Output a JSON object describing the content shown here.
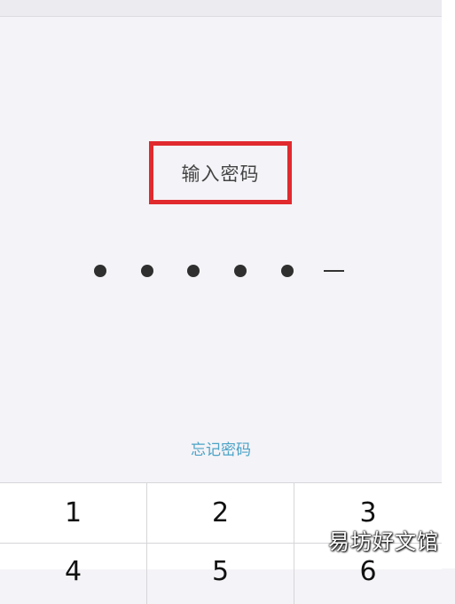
{
  "prompt": {
    "title": "输入密码",
    "entered_count": 5,
    "total_length": 6
  },
  "forgot_password_label": "忘记密码",
  "keypad": {
    "keys": [
      "1",
      "2",
      "3",
      "4",
      "5",
      "6"
    ]
  },
  "watermark": "易坊好文馆",
  "colors": {
    "highlight_box": "#e02a2e",
    "link": "#4ba3c7",
    "background": "#f4f3f7"
  }
}
